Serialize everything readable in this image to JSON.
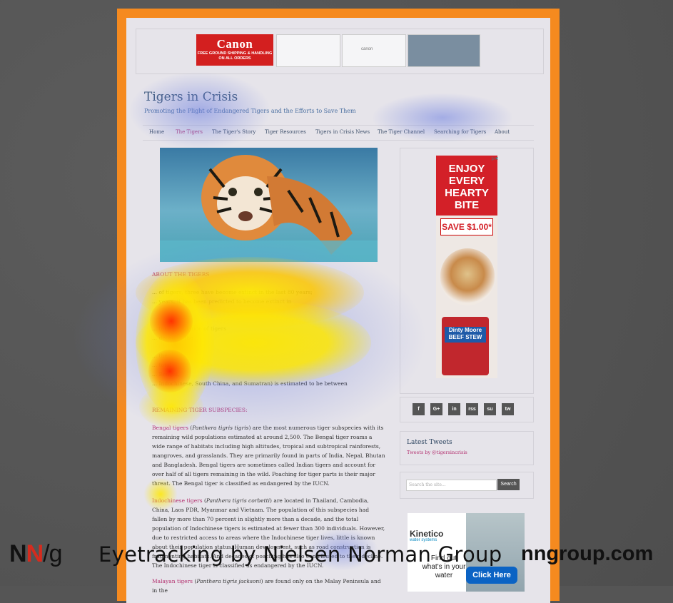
{
  "top_ad": {
    "canon_logo": "Canon",
    "canon_text": "FREE GROUND SHIPPING & HANDLING ON ALL ORDERS",
    "panel2_text": "canon"
  },
  "site": {
    "title": "Tigers in Crisis",
    "tagline": "Promoting the Plight of Endangered Tigers and the Efforts to Save Them"
  },
  "nav": {
    "items": [
      "Home",
      "The Tigers",
      "The Tiger's Story",
      "Tiger Resources",
      "Tigers in Crisis News",
      "The Tiger Channel",
      "Searching for Tigers",
      "About"
    ],
    "active": "The Tigers"
  },
  "article": {
    "p1": "... of tigers, three have become extinct in the last 80 years;",
    "p1b": "... years, it has been predicted to become extinct in",
    "p2": "... total population of tigers",
    "p2b": "... decades, the",
    "p3a": "... the",
    "p3b": "... total",
    "p3c": "... Bengal,",
    "p3d": "... Indochinese, South China, and Sumatran) is estimated to be between",
    "heading": "REMAINING TIGER SUBSPECIES:",
    "bengal_name": "Bengal tigers",
    "bengal_sci": "Panthera tigris tigris",
    "bengal_text": "are the most numerous tiger subspecies with its remaining wild populations estimated at around 2,500. The Bengal tiger roams a wide range of habitats including high altitudes, tropical and subtropical rainforests, mangroves, and grasslands. They are primarily found in parts of India, Nepal, Bhutan and Bangladesh. Bengal tigers are sometimes called Indian tigers and account for over half of all tigers remaining in the wild. Poaching for tiger parts is their major threat. The Bengal tiger is classified as endangered by the IUCN.",
    "indo_name": "Indochinese tigers",
    "indo_sci": "Panthera tigris corbetti",
    "indo_text": "are located in Thailand, Cambodia, China, Laos PDR, Myanmar and Vietnam. The population of this subspecies had fallen by more than 70 percent in slightly more than a decade, and the total population of Indochinese tigers is estimated at fewer than 300 individuals. However, due to restricted access to areas where the Indochinese tiger lives, little is known about their population status. Human development, such as road construction is fragmenting habitats. And decades of poaching has also contributed to their decline. The Indochinese tiger is classified as endangered by the IUCN.",
    "malayan_name": "Malayan tigers",
    "malayan_sci": "Panthera tigris jacksoni",
    "malayan_text": "are found only on the Malay Peninsula and in the"
  },
  "sidebar": {
    "ad_headline": "ENJOY EVERY HEARTY BITE",
    "ad_save": "SAVE $1.00*",
    "ad_can": "Dinty Moore BEEF STEW",
    "social": [
      "f",
      "G+",
      "in",
      "rss",
      "su",
      "tw"
    ],
    "tweets_heading": "Latest Tweets",
    "tweets_link": "Tweets by @tigersincrisis",
    "search_placeholder": "Search the site...",
    "search_button": "Search",
    "kinetico_brand": "Kinetico",
    "kinetico_sub": "water systems",
    "kinetico_question": "Find out what's in your water",
    "kinetico_button": "Click Here"
  },
  "banner": {
    "logo_n1": "N",
    "logo_n2": "N",
    "logo_g": "/g",
    "caption": "Eyetracking by Nielsen Norman Group",
    "site": "nngroup.com"
  },
  "colors": {
    "frame": "#f58a1f",
    "page_bg": "#e6e4ea",
    "link_pink": "#b3306f",
    "heat_hot": "#ff2a00",
    "heat_warm": "#ffe800",
    "heat_cool": "#6d7fe0"
  }
}
